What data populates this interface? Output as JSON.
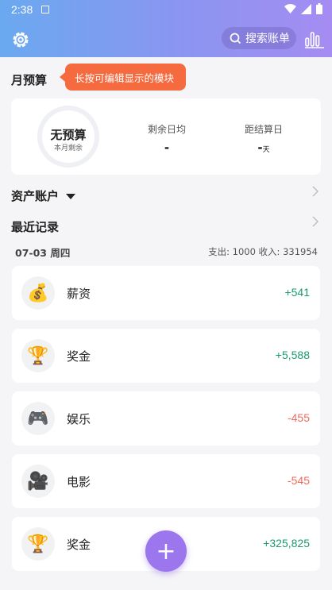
{
  "status_bar": {
    "time": "2:38"
  },
  "toolbar": {
    "search_label": "搜索账单"
  },
  "budget": {
    "title": "月预算",
    "tooltip": "长按可编辑显示的模块",
    "ring_main": "无预算",
    "ring_sub": "本月剩余",
    "daily_avg_label": "剩余日均",
    "daily_avg_value": "-",
    "settle_label": "距结算日",
    "settle_value": "-",
    "settle_unit": "天"
  },
  "assets": {
    "title": "资产账户"
  },
  "recent": {
    "title": "最近记录",
    "date": "07-03 周四",
    "totals": "支出: 1000  收入: 331954",
    "records": [
      {
        "icon": "money-bag-icon",
        "glyph": "💰",
        "name": "薪资",
        "amount": "+541",
        "type": "income"
      },
      {
        "icon": "trophy-icon",
        "glyph": "🏆",
        "name": "奖金",
        "amount": "+5,588",
        "type": "income"
      },
      {
        "icon": "gamepad-icon",
        "glyph": "🎮",
        "name": "娱乐",
        "amount": "-455",
        "type": "expense"
      },
      {
        "icon": "movie-camera-icon",
        "glyph": "🎥",
        "name": "电影",
        "amount": "-545",
        "type": "expense"
      },
      {
        "icon": "trophy-icon",
        "glyph": "🏆",
        "name": "奖金",
        "amount": "+325,825",
        "type": "income"
      }
    ]
  },
  "fab": {
    "label": "+"
  },
  "colors": {
    "income": "#1a9b6c",
    "expense": "#ef6a5e",
    "accent": "#9b76ec",
    "tooltip": "#f56a3e"
  }
}
